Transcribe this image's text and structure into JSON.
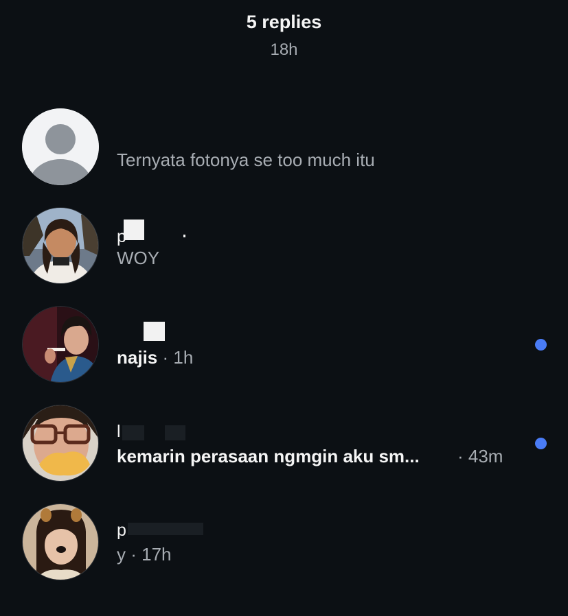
{
  "header": {
    "title": "5 replies",
    "subtitle": "18h"
  },
  "replies": [
    {
      "avatar": "default-avatar-icon",
      "username": "",
      "message": "Ternyata fotonya se too much itu",
      "time": "",
      "unread": false
    },
    {
      "avatar": "user-photo",
      "username": "p",
      "message": "WOY",
      "time": "",
      "unread": false
    },
    {
      "avatar": "user-photo",
      "username": "",
      "message": "najis",
      "time": "· 1h",
      "unread": true
    },
    {
      "avatar": "user-photo",
      "username": "l",
      "message": "kemarin perasaan ngmgin aku sm...",
      "time": "· 43m",
      "unread": true
    },
    {
      "avatar": "user-photo",
      "username": "p",
      "message": "y",
      "time": "· 17h",
      "unread": false
    }
  ],
  "colors": {
    "background": "#0c1014",
    "primary_text": "#f5f5f5",
    "secondary_text": "#a8adb3",
    "unread_dot": "#4a7cf6"
  }
}
